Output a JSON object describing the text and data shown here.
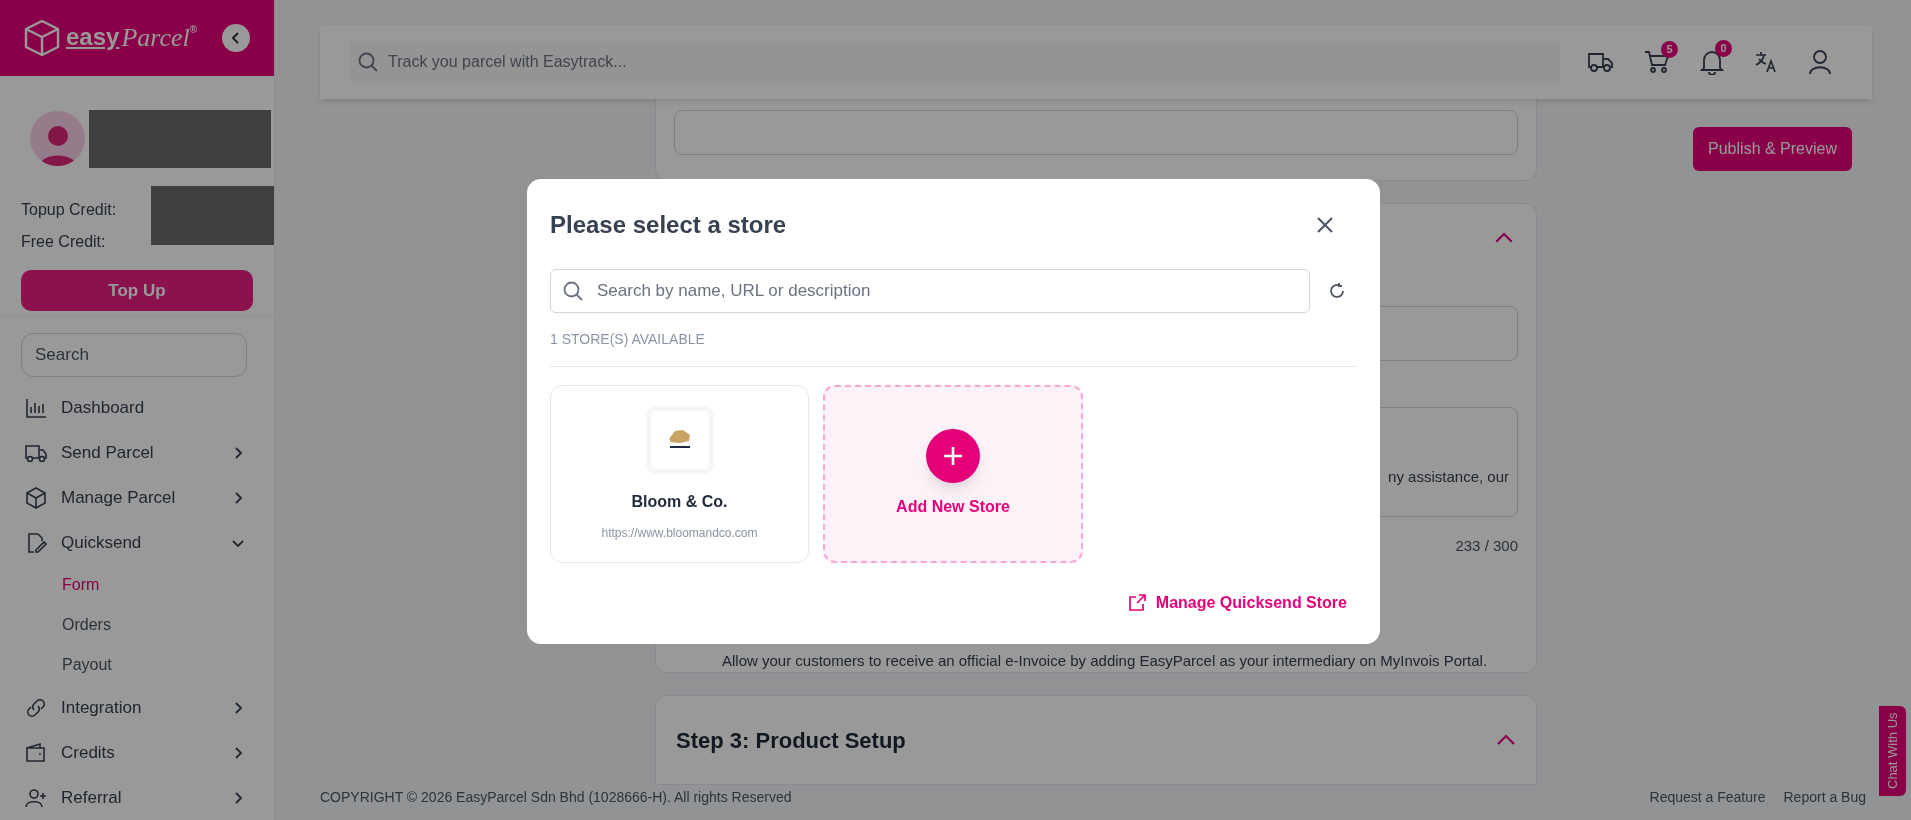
{
  "sidebar": {
    "logo": {
      "word": "easy",
      "script": "Parcel",
      "mark": "®"
    },
    "credits": [
      "Topup Credit:",
      "Free Credit:"
    ],
    "topup_button": "Top Up",
    "search": {
      "placeholder": "Search"
    },
    "nav": [
      {
        "label": "Dashboard",
        "expandable": false
      },
      {
        "label": "Send Parcel",
        "expandable": true,
        "expanded": false
      },
      {
        "label": "Manage Parcel",
        "expandable": true,
        "expanded": false
      },
      {
        "label": "Quicksend",
        "expandable": true,
        "expanded": true,
        "children": [
          {
            "label": "Form",
            "selected": true
          },
          {
            "label": "Orders",
            "selected": false
          },
          {
            "label": "Payout",
            "selected": false
          }
        ]
      },
      {
        "label": "Integration",
        "expandable": true,
        "expanded": false
      },
      {
        "label": "Credits",
        "expandable": true,
        "expanded": false
      },
      {
        "label": "Referral",
        "expandable": true,
        "expanded": false
      }
    ]
  },
  "header": {
    "search": {
      "placeholder": "Track you parcel with Easytrack..."
    },
    "cart_badge": "5",
    "notification_badge": "0"
  },
  "page": {
    "publish_button": "Publish & Preview",
    "textarea_excerpt": "ny assistance, our",
    "counter": "233 / 300",
    "einvoice_note": "Allow your customers to receive an official e-Invoice by adding EasyParcel as your intermediary on MyInvois Portal.",
    "step3_title": "Step 3: Product Setup"
  },
  "footer": {
    "copyright": "COPYRIGHT © 2026 EasyParcel Sdn Bhd (1028666-H). All rights Reserved",
    "links": [
      "Request a Feature",
      "Report a Bug"
    ]
  },
  "chat_tab": "Chat With Us",
  "modal": {
    "title": "Please select a store",
    "search": {
      "placeholder": "Search by name, URL or description"
    },
    "count": "1 STORE(S) AVAILABLE",
    "stores": [
      {
        "name": "Bloom & Co.",
        "url": "https://www.bloomandco.com"
      }
    ],
    "add_store": "Add New Store",
    "manage_link": "Manage Quicksend Store"
  }
}
